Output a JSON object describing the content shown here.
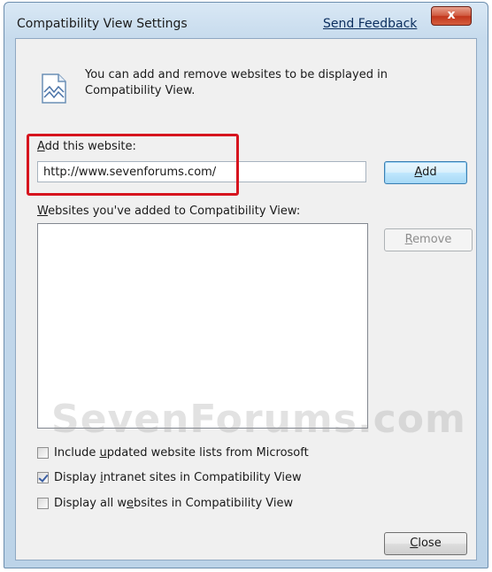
{
  "window": {
    "title": "Compatibility View Settings",
    "feedback_link": "Send Feedback",
    "close_glyph": "x"
  },
  "info": {
    "icon": "broken-page-icon",
    "text": "You can add and remove websites to be displayed in Compatibility View."
  },
  "add_website": {
    "label_accesskey": "A",
    "label_rest": "dd this website:",
    "value": "http://www.sevenforums.com/",
    "add_button_accesskey": "A",
    "add_button_rest": "dd"
  },
  "websites_list": {
    "label_accesskey": "W",
    "label_rest": "ebsites you've added to Compatibility View:",
    "remove_button_accesskey": "R",
    "remove_button_rest": "emove",
    "items": []
  },
  "watermark": "SevenForums.com",
  "options": [
    {
      "pre": "Include ",
      "key": "u",
      "post": "pdated website lists from Microsoft",
      "checked": false
    },
    {
      "pre": "Display ",
      "key": "i",
      "post": "ntranet sites in Compatibility View",
      "checked": true
    },
    {
      "pre": "Display all w",
      "key": "e",
      "post": "bsites in Compatibility View",
      "checked": false
    }
  ],
  "close_button": {
    "accesskey": "C",
    "rest": "lose"
  },
  "colors": {
    "highlight": "#d6141e",
    "title_close_button": "#c2361c",
    "default_button_border": "#3c7fb1"
  }
}
